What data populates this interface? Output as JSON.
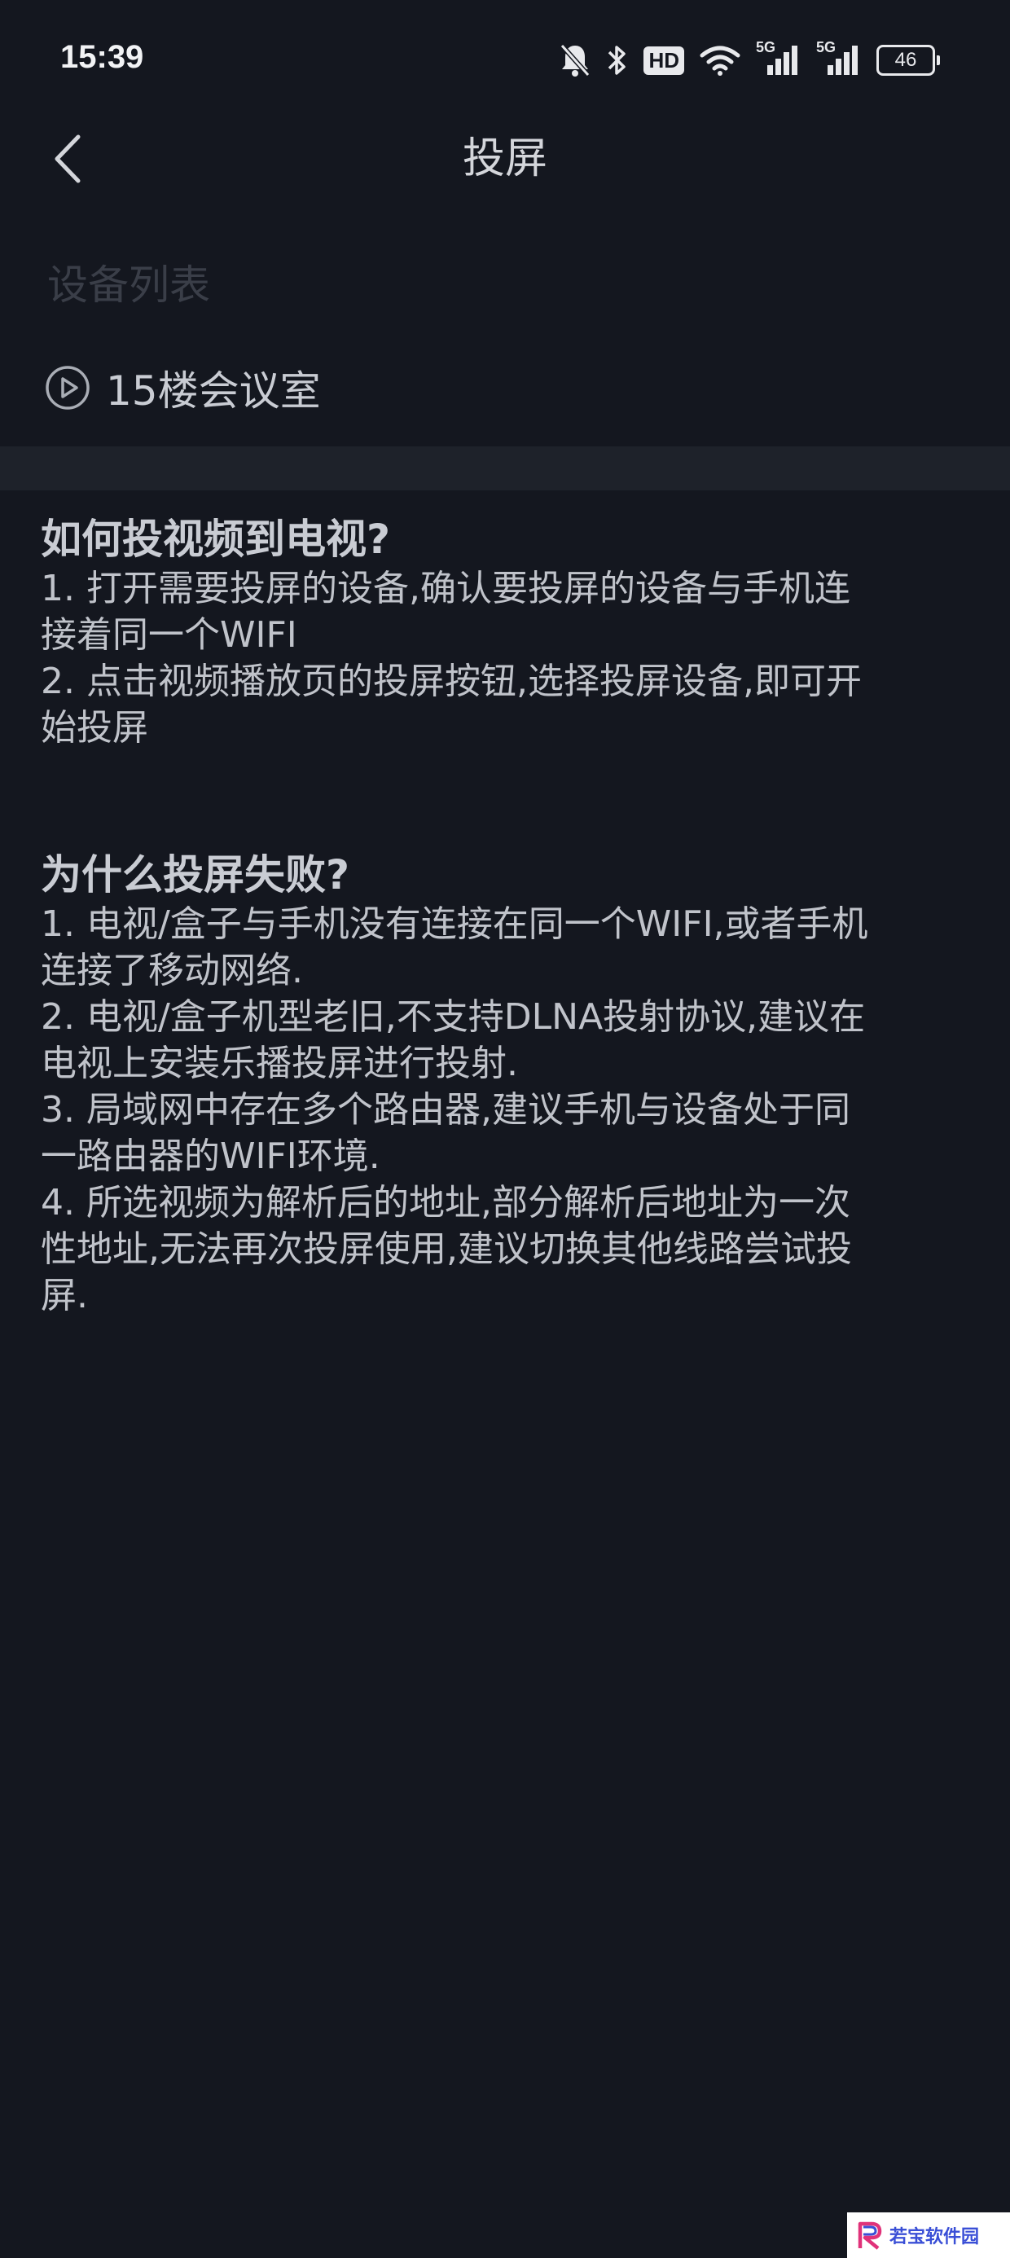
{
  "status_bar": {
    "time": "15:39",
    "hd_label": "HD",
    "signal1_label": "5G",
    "signal2_label": "5G",
    "battery": "46",
    "icons": [
      "bell-muted-icon",
      "bluetooth-icon",
      "hd-icon",
      "wifi-icon",
      "signal-icon",
      "signal-icon",
      "battery-icon"
    ]
  },
  "nav": {
    "title": "投屏",
    "back_icon": "chevron-left-icon"
  },
  "devices": {
    "label": "设备列表",
    "items": [
      {
        "name": "15楼会议室",
        "icon": "play-circle-icon"
      }
    ]
  },
  "help": {
    "how": {
      "title": "如何投视频到电视?",
      "lines": [
        "1. 打开需要投屏的设备,确认要投屏的设备与手机连",
        "接着同一个WIFI",
        "2. 点击视频播放页的投屏按钮,选择投屏设备,即可开",
        "始投屏"
      ]
    },
    "why": {
      "title": "为什么投屏失败?",
      "lines": [
        "1. 电视/盒子与手机没有连接在同一个WIFI,或者手机",
        "连接了移动网络.",
        "2. 电视/盒子机型老旧,不支持DLNA投射协议,建议在",
        "电视上安装乐播投屏进行投射.",
        "3. 局域网中存在多个路由器,建议手机与设备处于同",
        "一路由器的WIFI环境.",
        "4. 所选视频为解析后的地址,部分解析后地址为一次",
        "性地址,无法再次投屏使用,建议切换其他线路尝试投",
        "屏."
      ]
    }
  },
  "watermark": {
    "text": "若宝软件园",
    "icon": "logo-icon"
  },
  "colors": {
    "background": "#14171f",
    "band": "#1e222a",
    "text": "#c9ccd3",
    "muted_label": "#3a3e48"
  }
}
